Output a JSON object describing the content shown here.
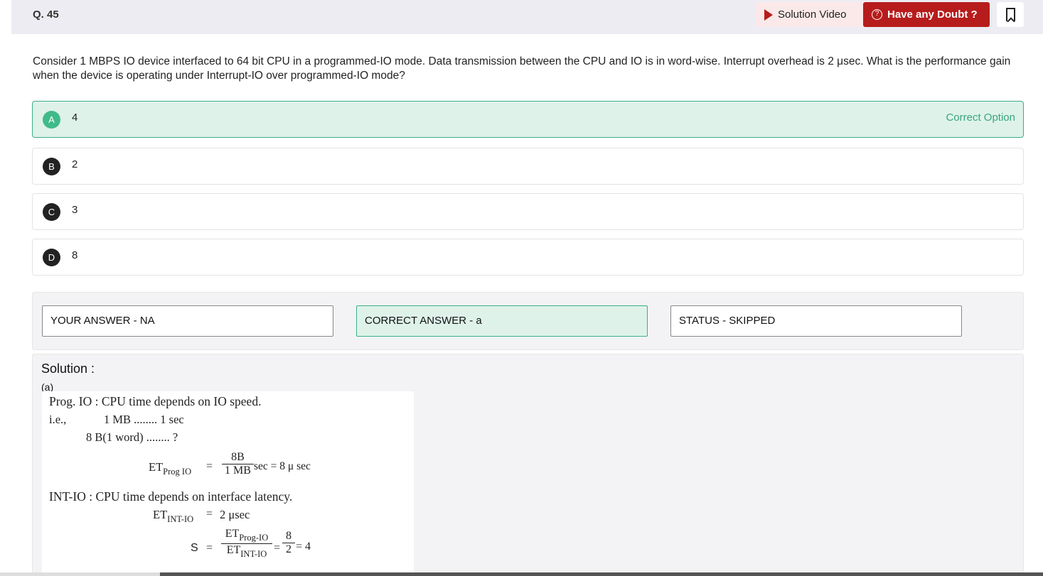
{
  "header": {
    "question_no": "Q. 45",
    "solution_video_label": "Solution Video",
    "doubt_label": "Have any Doubt ?",
    "doubt_icon_glyph": "?"
  },
  "question": {
    "text": "Consider 1 MBPS IO device interfaced to 64 bit CPU in a programmed-IO mode. Data transmission between the CPU and IO is in word-wise. Interrupt overhead is 2 μsec. What is the performance gain when the device is operating under Interrupt-IO over programmed-IO mode?"
  },
  "options": [
    {
      "letter": "A",
      "value": "4",
      "tag": "Correct Option"
    },
    {
      "letter": "B",
      "value": "2"
    },
    {
      "letter": "C",
      "value": "3"
    },
    {
      "letter": "D",
      "value": "8"
    }
  ],
  "answers": {
    "your_answer": "YOUR ANSWER - NA",
    "correct_answer": "CORRECT ANSWER - a",
    "status": "STATUS - SKIPPED"
  },
  "solution": {
    "title": "Solution :",
    "answer_marker": "(a)",
    "lines": {
      "l1": "Prog. IO : CPU time depends on IO speed.",
      "l2a": "i.e.,",
      "l2b": "1 MB ........ 1 sec",
      "l3": "8 B(1 word) ........ ?",
      "et_prog": "ET",
      "et_prog_sub": "Prog IO",
      "eq1": "=",
      "frac1_num": "8B",
      "frac1_den": "1 MB",
      "frac1_tail": "sec = 8 μ sec",
      "l5": "INT-IO : CPU time depends on interface latency.",
      "et_int": "ET",
      "et_int_sub": "INT-IO",
      "eq2": "=",
      "int_val": "2 μsec",
      "s_label": "S",
      "eq3": "=",
      "frac2_num": "ET",
      "frac2_num_sub": "Prog-IO",
      "frac2_den": "ET",
      "frac2_den_sub": "INT-IO",
      "eq4": "=",
      "frac3_num": "8",
      "frac3_den": "2",
      "result": "= 4"
    }
  },
  "colors": {
    "accent_red": "#b71c1c",
    "correct_green": "#3fba8a",
    "correct_bg": "#def2ea"
  }
}
